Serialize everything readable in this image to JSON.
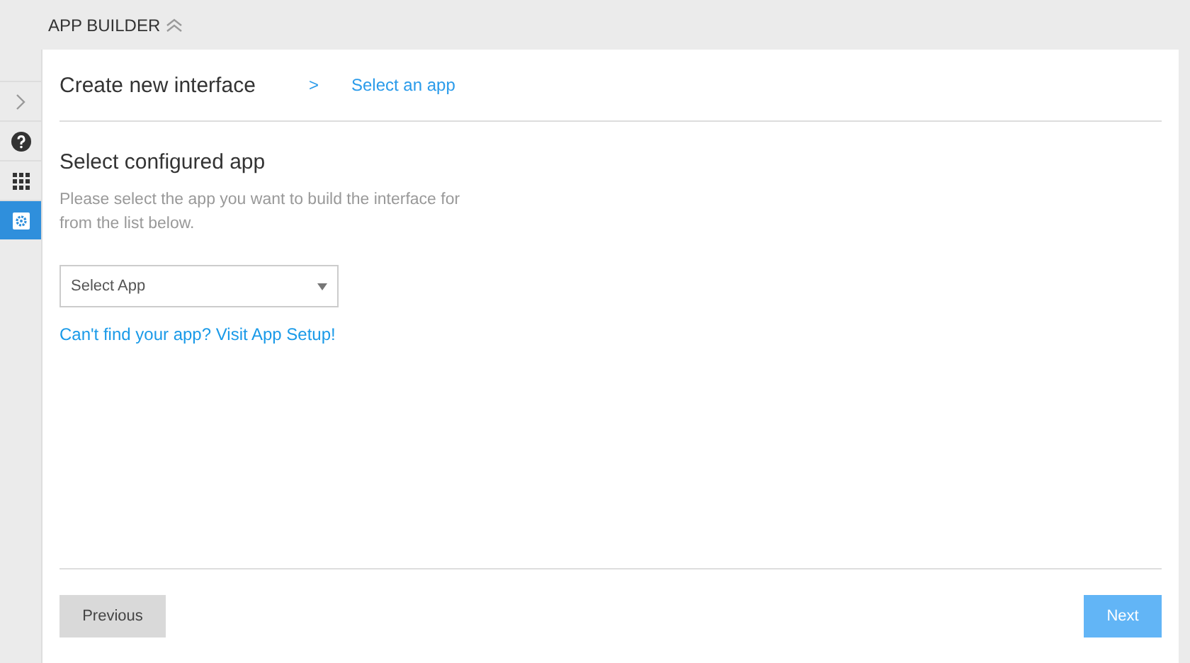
{
  "header": {
    "title": "APP BUILDER"
  },
  "sidebar": {
    "items": [
      {
        "kind": "help",
        "selected": false
      },
      {
        "kind": "grid",
        "selected": false
      },
      {
        "kind": "gear",
        "selected": true
      }
    ]
  },
  "breadcrumb": {
    "title": "Create new interface",
    "separator": ">",
    "step": "Select an app"
  },
  "section": {
    "heading": "Select configured app",
    "description": "Please select the app you want to build the interface for from the list below.",
    "select": {
      "placeholder": "Select App"
    },
    "link": "Can't find your app? Visit App Setup!"
  },
  "footer": {
    "previous": "Previous",
    "next": "Next"
  }
}
